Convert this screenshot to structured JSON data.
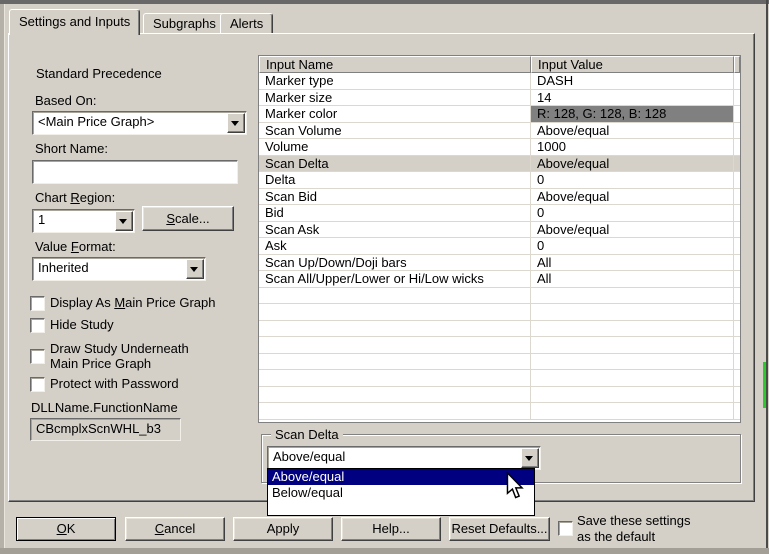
{
  "tabs": [
    {
      "label": "Settings and Inputs",
      "active": true
    },
    {
      "label": "Subgraphs",
      "active": false
    },
    {
      "label": "Alerts",
      "active": false
    }
  ],
  "left_panel": {
    "precedence_label": "Standard Precedence",
    "based_on_label": "Based On:",
    "based_on_value": "<Main Price Graph>",
    "short_name_label": "Short Name:",
    "short_name_value": "",
    "chart_region_label": {
      "pre": "Chart ",
      "u": "R",
      "post": "egion:"
    },
    "chart_region_value": "1",
    "scale_button": {
      "u": "S",
      "post": "cale..."
    },
    "value_format_label": {
      "pre": "Value ",
      "u": "F",
      "post": "ormat:"
    },
    "value_format_value": "Inherited",
    "checkbox_display": {
      "pre": "Display As ",
      "u": "M",
      "post": "ain Price Graph"
    },
    "checkbox_hide": "Hide Study",
    "checkbox_draw_line1": "Draw Study Underneath",
    "checkbox_draw_line2": "Main Price Graph",
    "checkbox_protect": "Protect with Password",
    "dll_label": "DLLName.FunctionName",
    "dll_value": "CBcmplxScnWHL_b3"
  },
  "inputs_table": {
    "col_name": "Input Name",
    "col_value": "Input Value",
    "rows": [
      {
        "name": "Marker type",
        "value": "DASH"
      },
      {
        "name": "Marker size",
        "value": "14"
      },
      {
        "name": "Marker color",
        "value": "R: 128, G: 128, B: 128",
        "color_cell": true
      },
      {
        "name": "Scan Volume",
        "value": "Above/equal"
      },
      {
        "name": "Volume",
        "value": "1000"
      },
      {
        "name": "Scan Delta",
        "value": "Above/equal",
        "selected": true
      },
      {
        "name": "Delta",
        "value": "0"
      },
      {
        "name": "Scan Bid",
        "value": "Above/equal"
      },
      {
        "name": "Bid",
        "value": "0"
      },
      {
        "name": "Scan Ask",
        "value": "Above/equal"
      },
      {
        "name": "Ask",
        "value": "0"
      },
      {
        "name": "Scan Up/Down/Doji bars",
        "value": "All"
      },
      {
        "name": "Scan All/Upper/Lower or Hi/Low wicks",
        "value": "All"
      }
    ],
    "empty_row_count": 8
  },
  "scan_delta_editor": {
    "group_label": "Scan Delta",
    "combo_value": "Above/equal",
    "options": [
      {
        "label": "Above/equal",
        "selected": true
      },
      {
        "label": "Below/equal",
        "selected": false
      }
    ]
  },
  "footer": {
    "ok": {
      "u": "O",
      "post": "K"
    },
    "cancel": {
      "u": "C",
      "post": "ancel"
    },
    "apply": "Apply",
    "help": "Help...",
    "reset": "Reset Defaults...",
    "save_line1": "Save these settings",
    "save_line2": "as the default"
  },
  "colors": {
    "selection": "#000080",
    "marker_color_cell": "#808080",
    "row_highlight": "#d4d0c8",
    "chart_green": "#2ec92e"
  }
}
